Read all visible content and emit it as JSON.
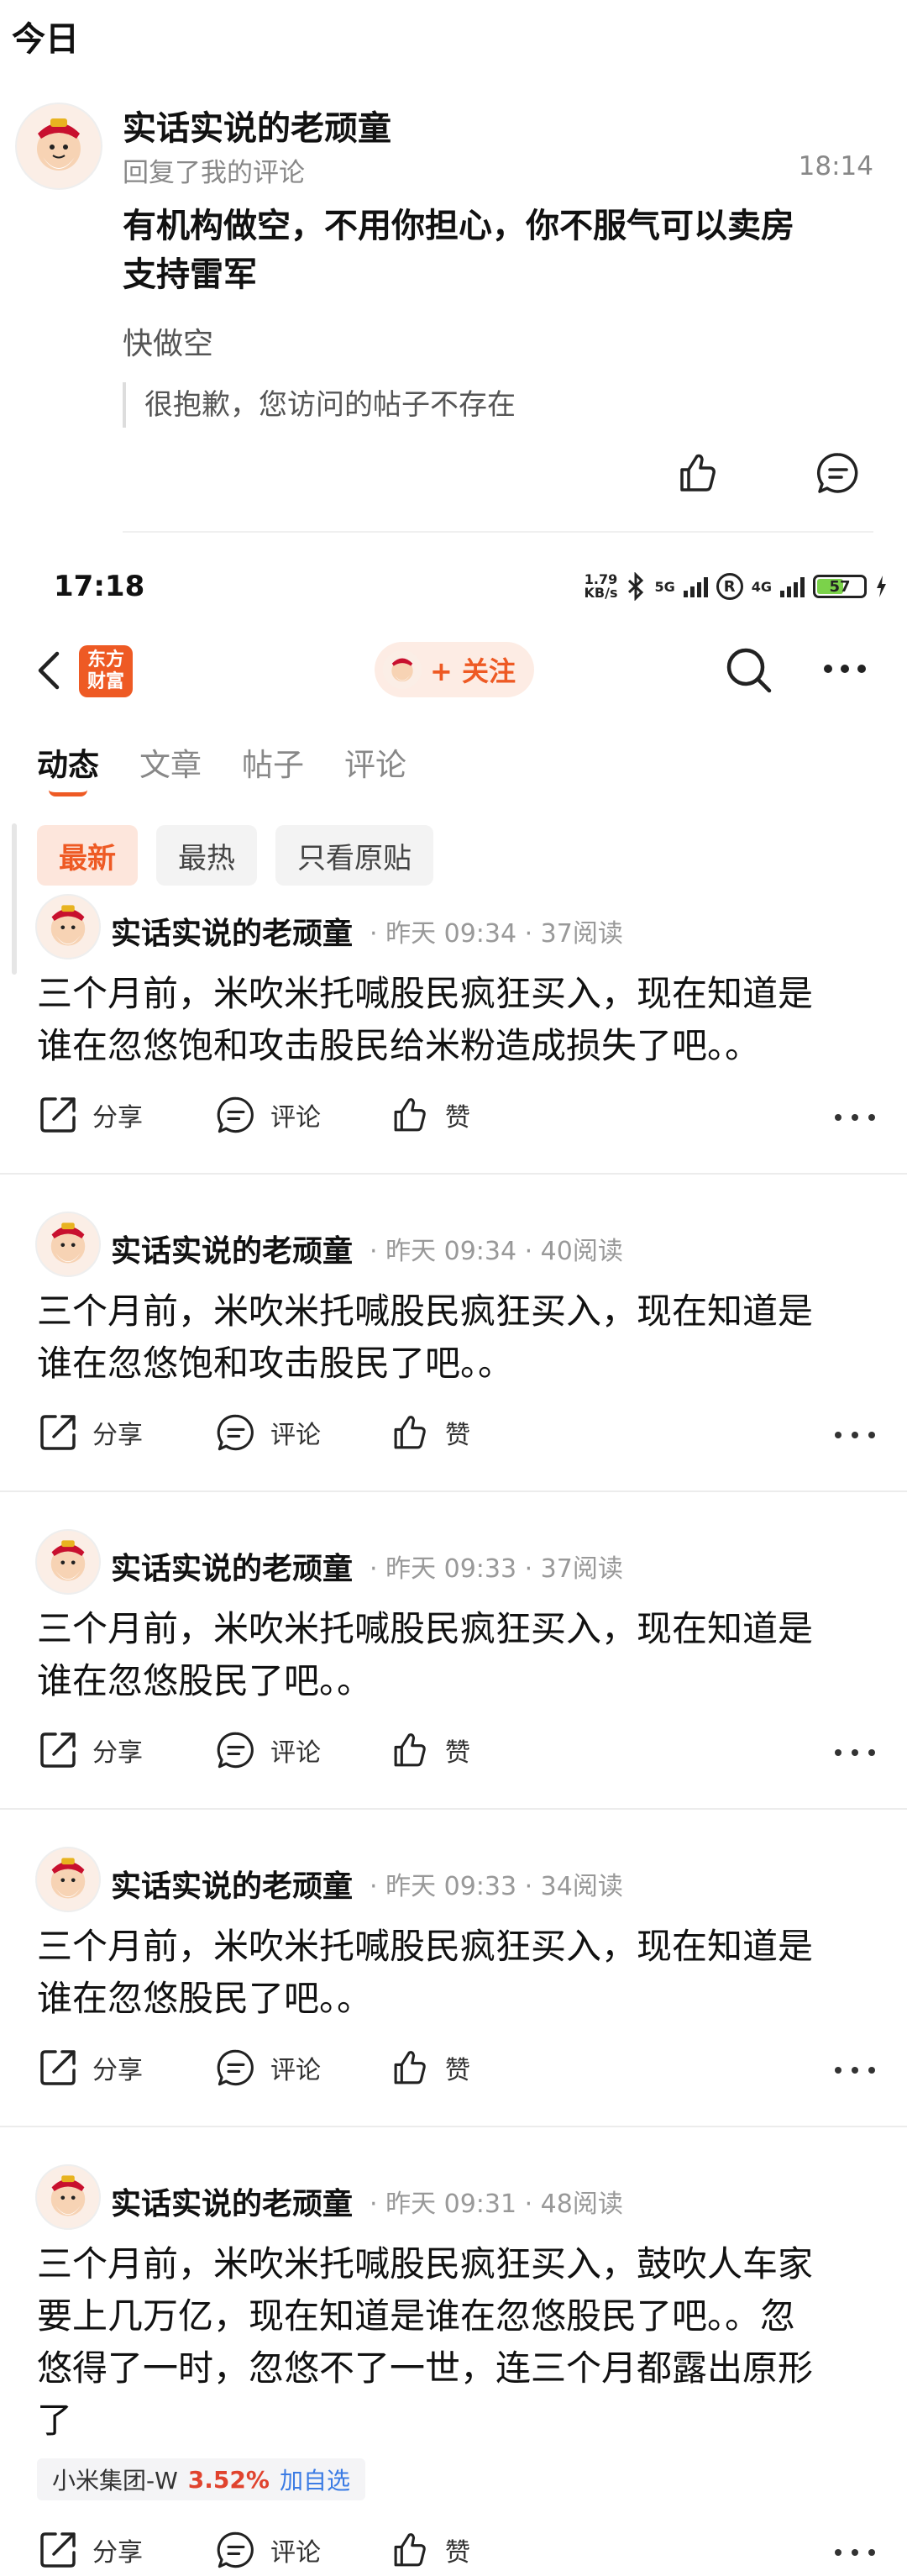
{
  "day_header": "今日",
  "notification": {
    "user": "实话实说的老顽童",
    "action": "回复了我的评论",
    "time": "18:14",
    "reply_line1": "有机构做空，不用你担心，你不服气可以卖房",
    "reply_line2": "支持雷军",
    "my_comment": "快做空",
    "ref_post": "很抱歉，您访问的帖子不存在"
  },
  "statusbar": {
    "time": "17:18",
    "net_speed_value": "1.79",
    "net_speed_unit": "KB/s",
    "net_5g": "5G",
    "net_4g": "4G",
    "battery": "57",
    "battery_level": 0.57,
    "reg_mark": "R"
  },
  "nav": {
    "logo_line1": "东方",
    "logo_line2": "财富",
    "follow_label": "+ 关注"
  },
  "tabs": [
    {
      "label": "动态",
      "active": true
    },
    {
      "label": "文章",
      "active": false
    },
    {
      "label": "帖子",
      "active": false
    },
    {
      "label": "评论",
      "active": false
    }
  ],
  "filters": [
    {
      "label": "最新",
      "active": true
    },
    {
      "label": "最热",
      "active": false
    },
    {
      "label": "只看原贴",
      "active": false
    }
  ],
  "actions": {
    "share": "分享",
    "comment": "评论",
    "like": "赞"
  },
  "posts": [
    {
      "author": "实话实说的老顽童",
      "meta": "· 昨天 09:34 · 37阅读",
      "line1": "三个月前，米吹米托喊股民疯狂买入，现在知道是",
      "line2": "谁在忽悠饱和攻击股民给米粉造成损失了吧。。"
    },
    {
      "author": "实话实说的老顽童",
      "meta": "· 昨天 09:34 · 40阅读",
      "line1": "三个月前，米吹米托喊股民疯狂买入，现在知道是",
      "line2": "谁在忽悠饱和攻击股民了吧。。"
    },
    {
      "author": "实话实说的老顽童",
      "meta": "· 昨天 09:33 · 37阅读",
      "line1": "三个月前，米吹米托喊股民疯狂买入，现在知道是",
      "line2": "谁在忽悠股民了吧。。"
    },
    {
      "author": "实话实说的老顽童",
      "meta": "· 昨天 09:33 · 34阅读",
      "line1": "三个月前，米吹米托喊股民疯狂买入，现在知道是",
      "line2": "谁在忽悠股民了吧。。"
    },
    {
      "author": "实话实说的老顽童",
      "meta": "· 昨天 09:31 · 48阅读",
      "line1": "三个月前，米吹米托喊股民疯狂买入，鼓吹人车家",
      "line2": "要上几万亿，现在知道是谁在忽悠股民了吧。。忽",
      "line3": "悠得了一时，忽悠不了一世，连三个月都露出原形",
      "line4": "了",
      "stock_name": "小米集团-W",
      "stock_change": "3.52%",
      "stock_add": "加自选"
    }
  ],
  "colors": {
    "accent": "#ee5a24",
    "up_red": "#e0432e",
    "link_blue": "#3b7be4"
  }
}
